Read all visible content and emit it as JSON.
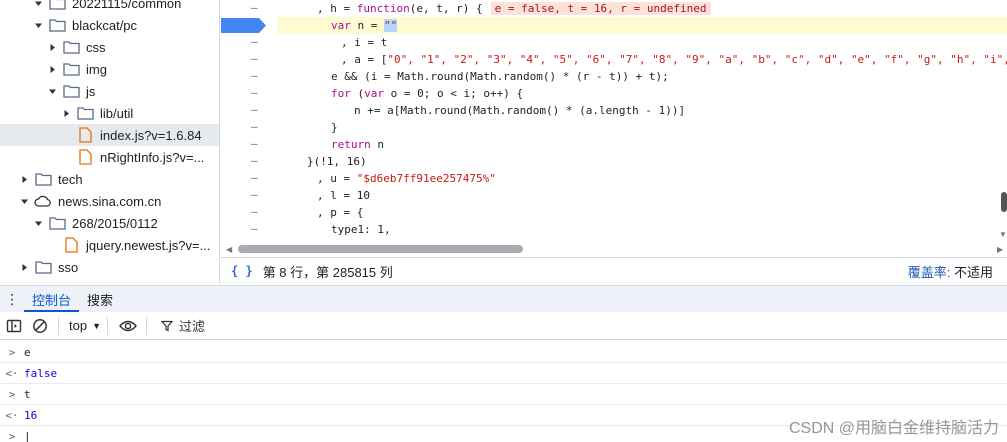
{
  "file_tree": [
    {
      "label": "20221115/common",
      "depth": 2,
      "type": "folder",
      "expanded": true
    },
    {
      "label": "blackcat/pc",
      "depth": 2,
      "type": "folder",
      "expanded": true
    },
    {
      "label": "css",
      "depth": 3,
      "type": "folder",
      "expanded": false
    },
    {
      "label": "img",
      "depth": 3,
      "type": "folder",
      "expanded": false
    },
    {
      "label": "js",
      "depth": 3,
      "type": "folder",
      "expanded": true
    },
    {
      "label": "lib/util",
      "depth": 4,
      "type": "folder",
      "expanded": false
    },
    {
      "label": "index.js?v=1.6.84",
      "depth": 4,
      "type": "file",
      "selected": true
    },
    {
      "label": "nRightInfo.js?v=...",
      "depth": 4,
      "type": "file"
    },
    {
      "label": "tech",
      "depth": 1,
      "type": "folder",
      "expanded": false
    },
    {
      "label": "news.sina.com.cn",
      "depth": 1,
      "type": "domain",
      "expanded": true
    },
    {
      "label": "268/2015/0112",
      "depth": 2,
      "type": "folder",
      "expanded": true
    },
    {
      "label": "jquery.newest.js?v=...",
      "depth": 3,
      "type": "file"
    },
    {
      "label": "sso",
      "depth": 1,
      "type": "folder",
      "expanded": false
    }
  ],
  "editor": {
    "line1_prefix": ", h = ",
    "line1_kw": "function",
    "line1_args": "(e, t, r) {",
    "line1_inline": "e = false, t = 16, r = undefined",
    "line2_kw": "var",
    "line2_text": " n = ",
    "line2_sel": "\"\"",
    "line3": ", i = t",
    "line4_prefix": ", a = [",
    "line4_strings": "\"0\", \"1\", \"2\", \"3\", \"4\", \"5\", \"6\", \"7\", \"8\", \"9\", \"a\", \"b\", \"c\", \"d\", \"e\", \"f\", \"g\", \"h\", \"i\", \"j\", \"k",
    "line5": "e && (i = Math.round(Math.random() * (r - t)) + t);",
    "line6_kw": "for",
    "line6_text": " (",
    "line6_kw2": "var",
    "line6_text2": " o = 0; o < i; o++) {",
    "line7": "n += a[Math.round(Math.random() * (a.length - 1))]",
    "line8": "}",
    "line9_kw": "return",
    "line9_text": " n",
    "line10": "}(!1, 16)",
    "line11_prefix": ", u = ",
    "line11_str": "\"$d6eb7ff91ee257475%\"",
    "line12": ", l = 10",
    "line13": ", p = {",
    "line14": "type1: 1,",
    "gutter_mark": "–"
  },
  "status": {
    "braces": "{ }",
    "position": "第 8 行，第 285815 列",
    "coverage_label": "覆盖率: ",
    "coverage_value": "不适用"
  },
  "drawer": {
    "menu": "⋮",
    "tabs": [
      "控制台",
      "搜索"
    ]
  },
  "console_toolbar": {
    "context": "top",
    "filter": "过滤"
  },
  "console_messages": [
    {
      "prompt": ">",
      "text": "e",
      "kind": "input"
    },
    {
      "prompt": "<·",
      "text": "false",
      "kind": "bool"
    },
    {
      "prompt": ">",
      "text": "t",
      "kind": "input"
    },
    {
      "prompt": "<·",
      "text": "16",
      "kind": "num"
    },
    {
      "prompt": ">",
      "text": "|",
      "kind": "input"
    }
  ],
  "watermark": "CSDN @用脑白金维持脑活力",
  "colors": {
    "folder_icon": "#5a6b85",
    "file_icon": "#e8710a",
    "accent": "#0b57d0"
  }
}
